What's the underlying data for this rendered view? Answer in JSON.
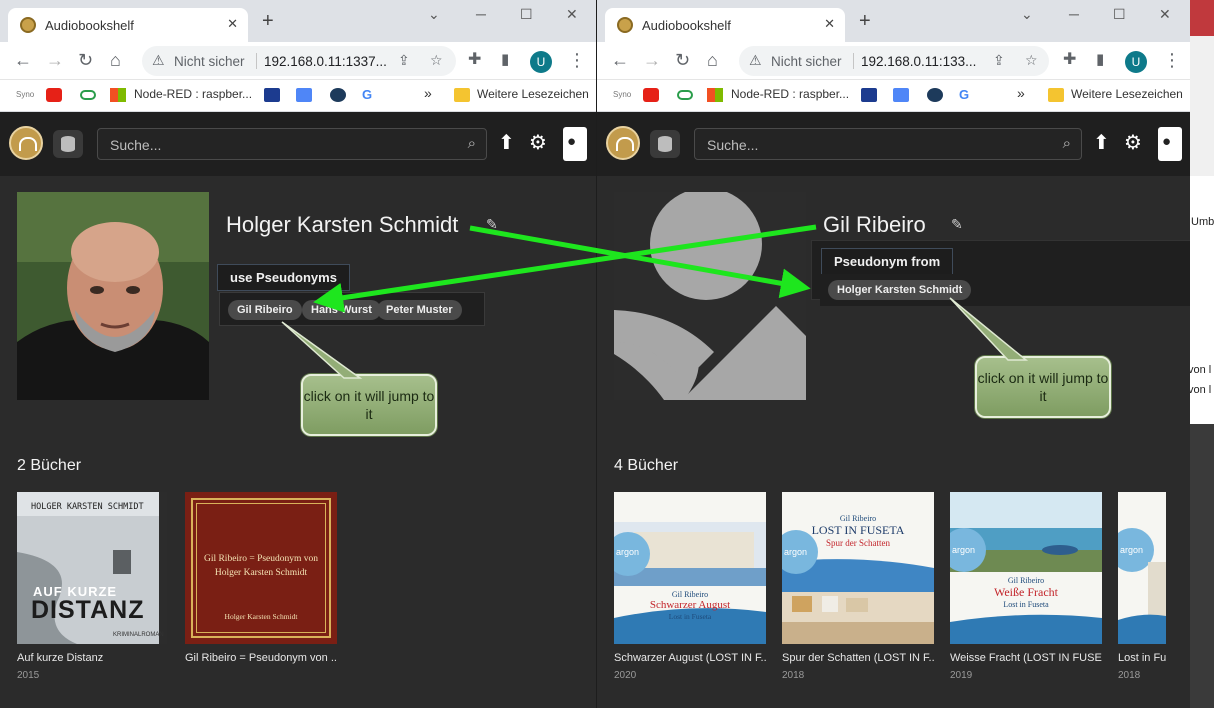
{
  "browser": {
    "tab_title": "Audiobookshelf",
    "tab_close": "✕",
    "new_tab": "+",
    "security_label": "Nicht sicher",
    "left_url": "192.168.0.11:1337...",
    "right_url": "192.168.0.11:133...",
    "account_initial": "U",
    "bookmarks": {
      "syno": "Syno",
      "node_red": "Node-RED : raspber...",
      "more": "»",
      "other": "Weitere Lesezeichen"
    }
  },
  "app": {
    "search_placeholder": "Suche..."
  },
  "left_page": {
    "author_name": "Holger Karsten Schmidt",
    "section_label": "use Pseudonyms",
    "chips": [
      "Gil Ribeiro",
      "Hans Wurst",
      "Peter Muster"
    ],
    "books_heading": "2 Bücher",
    "books": [
      {
        "title": "Auf kurze Distanz",
        "year": "2015",
        "cover_author": "HOLGER KARSTEN SCHMIDT",
        "cover_title_1": "AUF KURZE",
        "cover_title_2": "DISTANZ",
        "cover_sub": "KRIMINALROMAN"
      },
      {
        "title": "Gil Ribeiro = Pseudonym von ...",
        "year": "",
        "cover_line_1": "Gil Ribeiro = Pseudonym von",
        "cover_line_2": "Holger Karsten Schmidt",
        "cover_author": "Holger Karsten Schmidt"
      }
    ],
    "callout": "click on it will jump to it"
  },
  "right_page": {
    "author_name": "Gil Ribeiro",
    "section_label": "Pseudonym from",
    "chips": [
      "Holger Karsten Schmidt"
    ],
    "books_heading": "4 Bücher",
    "books": [
      {
        "title": "Schwarzer August (LOST IN F...",
        "year": "2020",
        "cover_author": "Gil Ribeiro",
        "cover_title": "Schwarzer August",
        "cover_series": "Lost in Fuseta"
      },
      {
        "title": "Spur der Schatten (LOST IN F...",
        "year": "2018",
        "cover_author": "Gil Ribeiro",
        "cover_title": "LOST IN FUSETA",
        "cover_series": "Spur der Schatten"
      },
      {
        "title": "Weisse Fracht (LOST IN FUSET...",
        "year": "2019",
        "cover_author": "Gil Ribeiro",
        "cover_title": "Weiße Fracht",
        "cover_series": "Lost in Fuseta"
      },
      {
        "title": "Lost in Fu...",
        "year": "2018"
      }
    ],
    "callout": "click on it will jump to it"
  },
  "background_window": {
    "texts": [
      "Umb",
      "von l",
      "von l"
    ]
  },
  "colors": {
    "arrow": "#1ee61e",
    "callout": "#93ad77",
    "app_bg": "#2b2b2b"
  },
  "icons": [
    "chrome-tab-favicon",
    "back-icon",
    "forward-icon",
    "reload-icon",
    "home-icon",
    "warning-icon",
    "share-icon",
    "star-icon",
    "extensions-icon",
    "sidepanel-icon",
    "menu-icon",
    "search-icon",
    "upload-icon",
    "gear-icon",
    "user-icon",
    "pencil-icon",
    "database-icon"
  ]
}
